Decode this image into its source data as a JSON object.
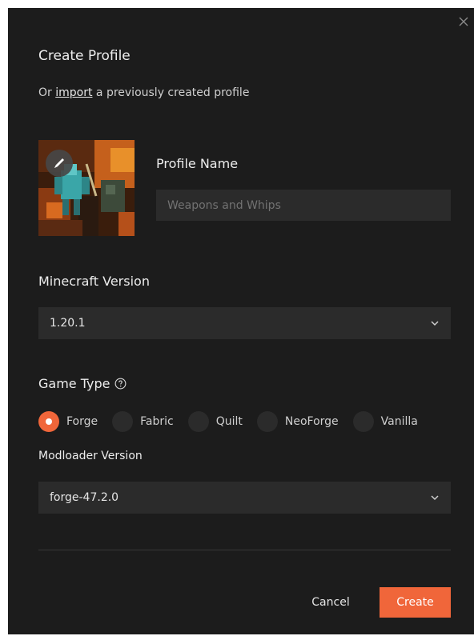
{
  "dialog": {
    "title": "Create Profile",
    "subtitle_prefix": "Or ",
    "subtitle_link": "import",
    "subtitle_suffix": " a previously created profile"
  },
  "profile": {
    "icon_edit": "pencil-icon",
    "name_label": "Profile Name",
    "name_value": "",
    "name_placeholder": "Weapons and Whips"
  },
  "minecraft_version": {
    "label": "Minecraft Version",
    "selected": "1.20.1"
  },
  "game_type": {
    "label": "Game Type",
    "help_icon": "question-circle-icon",
    "options": [
      {
        "label": "Forge",
        "checked": true
      },
      {
        "label": "Fabric",
        "checked": false
      },
      {
        "label": "Quilt",
        "checked": false
      },
      {
        "label": "NeoForge",
        "checked": false
      },
      {
        "label": "Vanilla",
        "checked": false
      }
    ]
  },
  "modloader_version": {
    "label": "Modloader Version",
    "selected": "forge-47.2.0"
  },
  "actions": {
    "cancel_label": "Cancel",
    "create_label": "Create"
  },
  "colors": {
    "background": "#1c1c1c",
    "field": "#2b2b2b",
    "accent": "#f0663a",
    "text": "#e8e8e8"
  }
}
